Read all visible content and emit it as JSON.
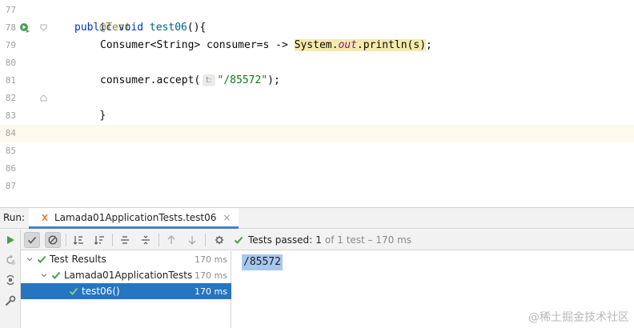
{
  "editor": {
    "line_numbers": [
      "77",
      "78",
      "79",
      "80",
      "81",
      "82",
      "83",
      "84",
      "85",
      "86",
      "87"
    ],
    "code": {
      "annotation": "@Test",
      "decl_kw": "public void",
      "decl_name": "test06",
      "decl_rest": "(){",
      "consumer_decl": "Consumer<String> consumer=s -> ",
      "sys": "System.",
      "out": "out",
      "println": ".println(s)",
      "semicolon": ";",
      "accept_prefix": "consumer.accept(",
      "param_hint": "t:",
      "accept_arg": "\"/85572\"",
      "accept_suffix": ");",
      "close_brace": "}"
    },
    "gutter_icons": {
      "run": "run-test-icon",
      "fold": "fold-marker-icon"
    }
  },
  "run_panel": {
    "label": "Run:",
    "tab_label": "Lamada01ApplicationTests.test06",
    "tab_close": "×",
    "status": {
      "passed_label": "Tests passed:",
      "passed_count": "1",
      "of_text": "of 1 test – 170 ms"
    },
    "tree": [
      {
        "label": "Test Results",
        "time": "170 ms"
      },
      {
        "label": "Lamada01ApplicationTests",
        "time": "170 ms"
      },
      {
        "label": "test06()",
        "time": "170 ms"
      }
    ],
    "console_output": "/85572"
  },
  "watermark": "@稀土掘金技术社区",
  "colors": {
    "accent": "#2675bf",
    "pass_green": "#499c54",
    "keyword": "#0033b3",
    "annotation": "#9e880d",
    "string": "#067d17"
  }
}
